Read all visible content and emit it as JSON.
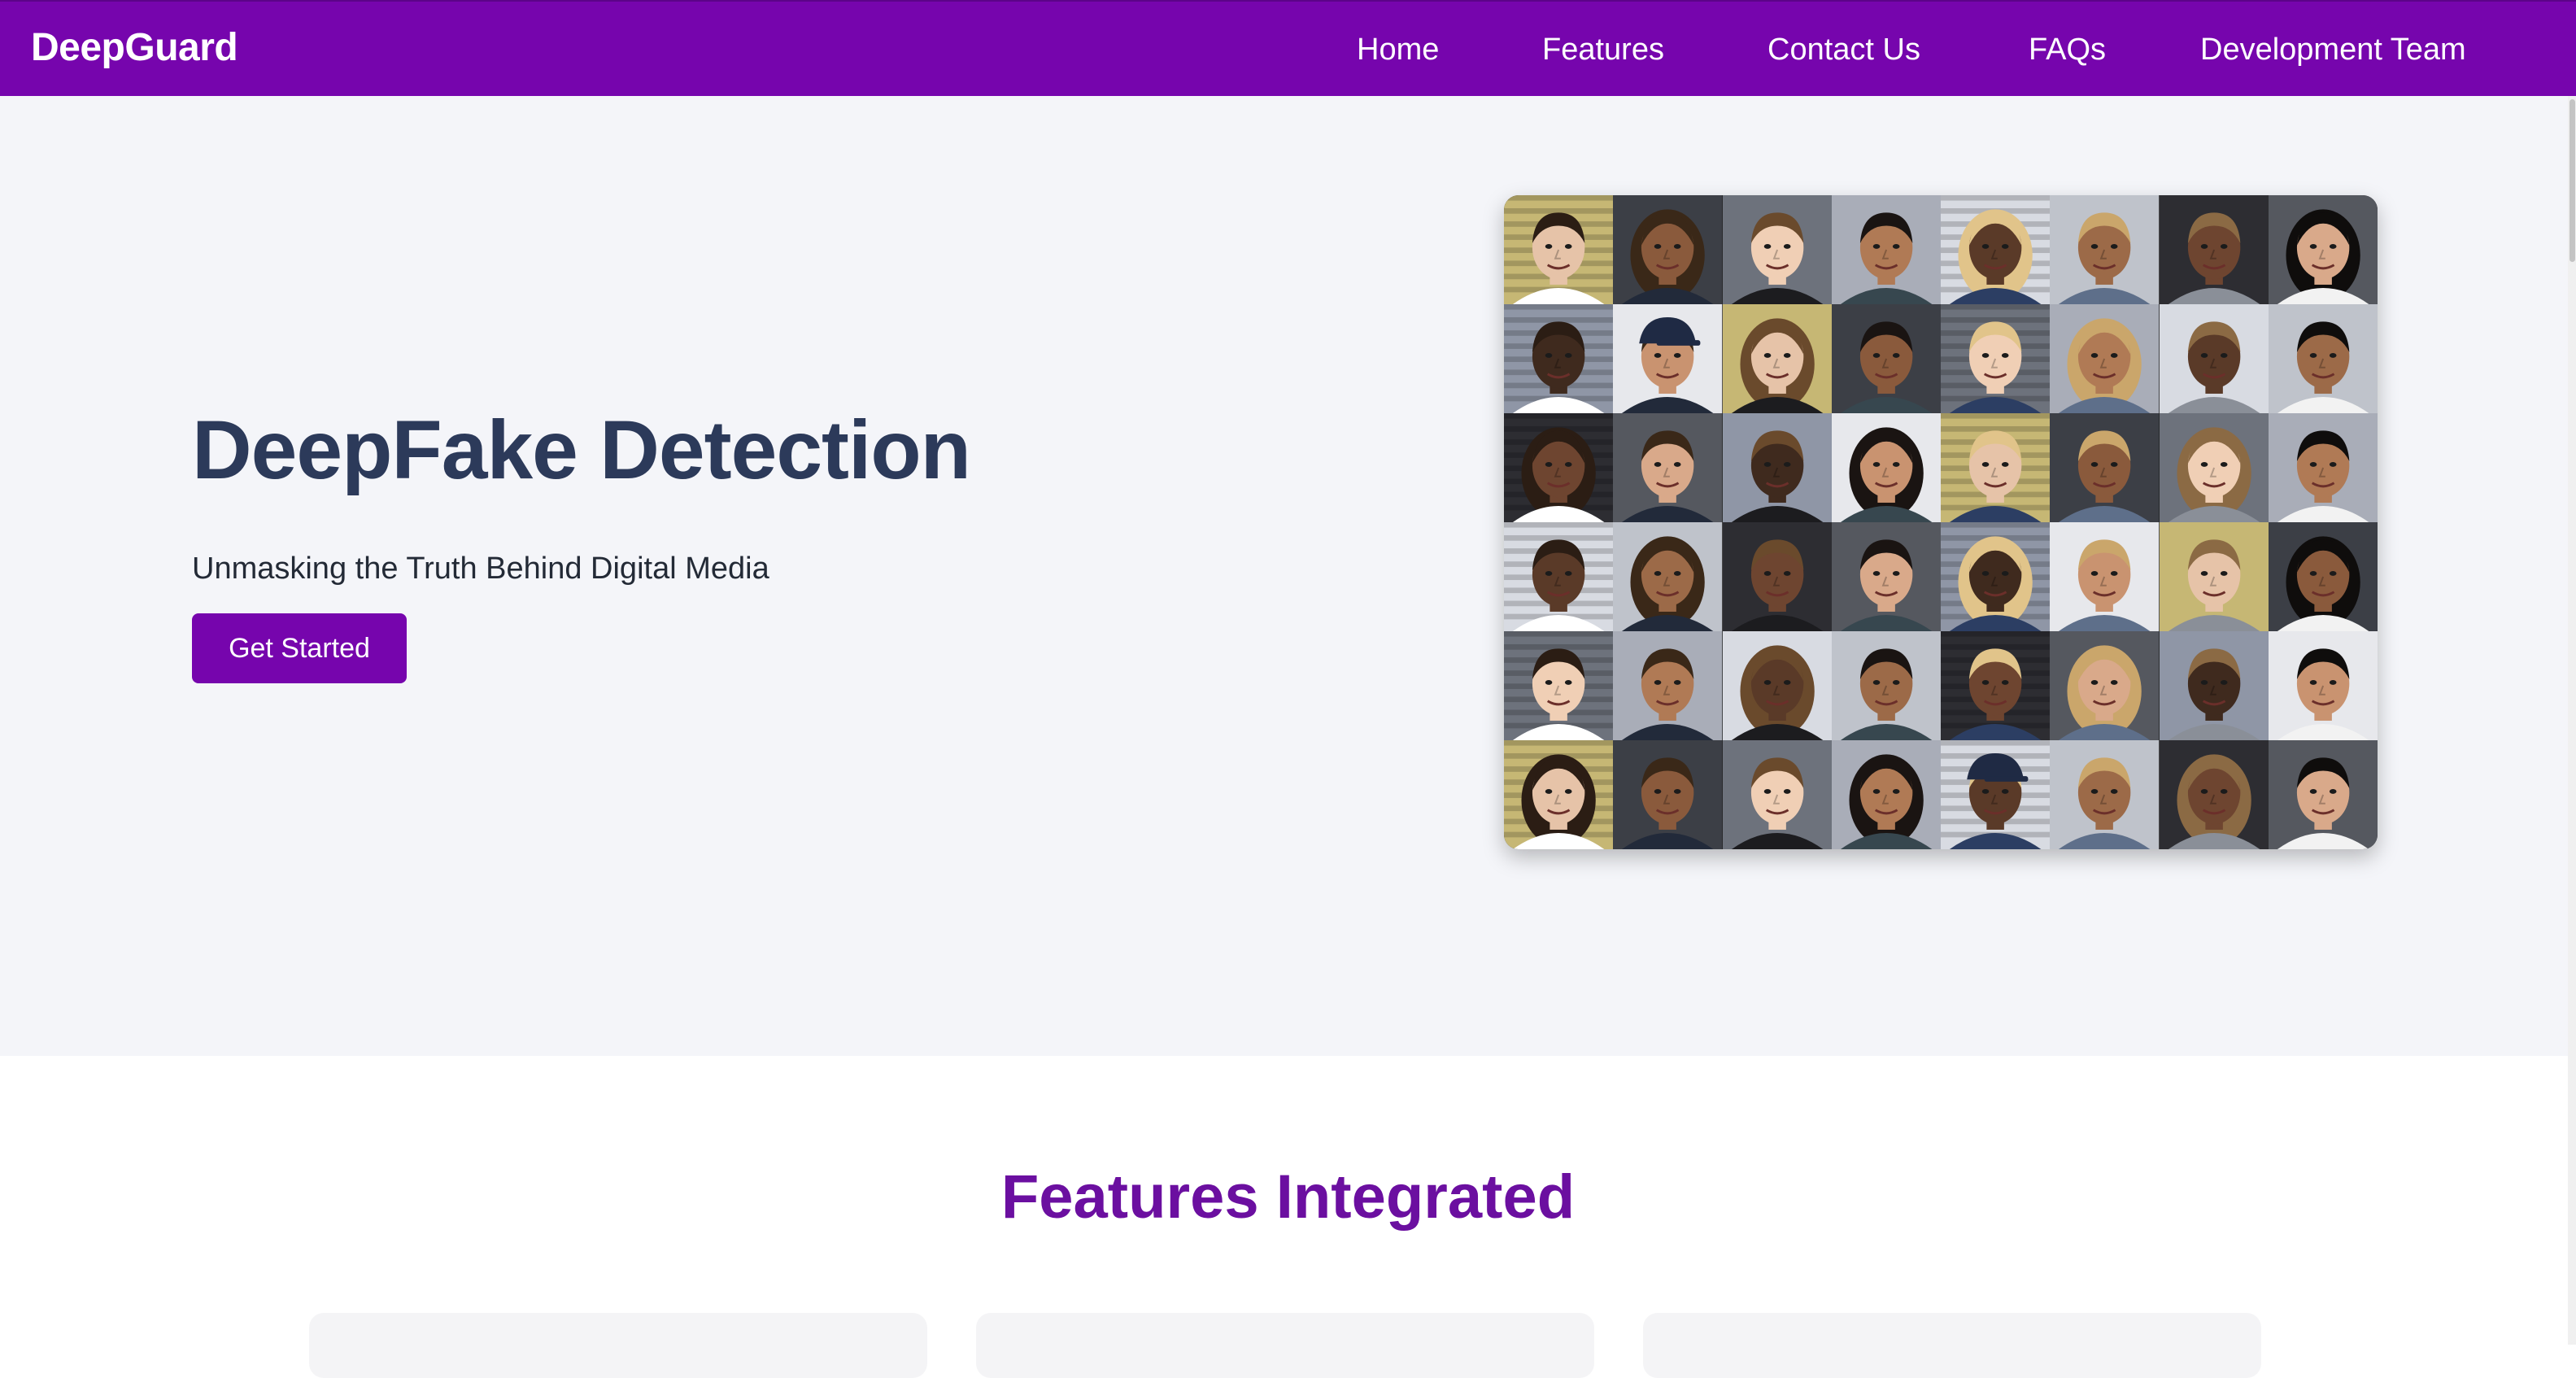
{
  "app": {
    "brand": "DeepGuard"
  },
  "nav": {
    "items": [
      {
        "label": "Home"
      },
      {
        "label": "Features"
      },
      {
        "label": "Contact Us"
      },
      {
        "label": "FAQs"
      },
      {
        "label": "Development Team"
      }
    ]
  },
  "hero": {
    "title": "DeepFake Detection",
    "subtitle": "Unmasking the Truth Behind Digital Media",
    "cta_label": "Get Started"
  },
  "features": {
    "title": "Features Integrated"
  },
  "colors": {
    "brand_purple": "#7605ad",
    "hero_background": "#f4f5f9",
    "title_navy": "#2c3a5a",
    "features_title_purple": "#6b0fa0"
  }
}
